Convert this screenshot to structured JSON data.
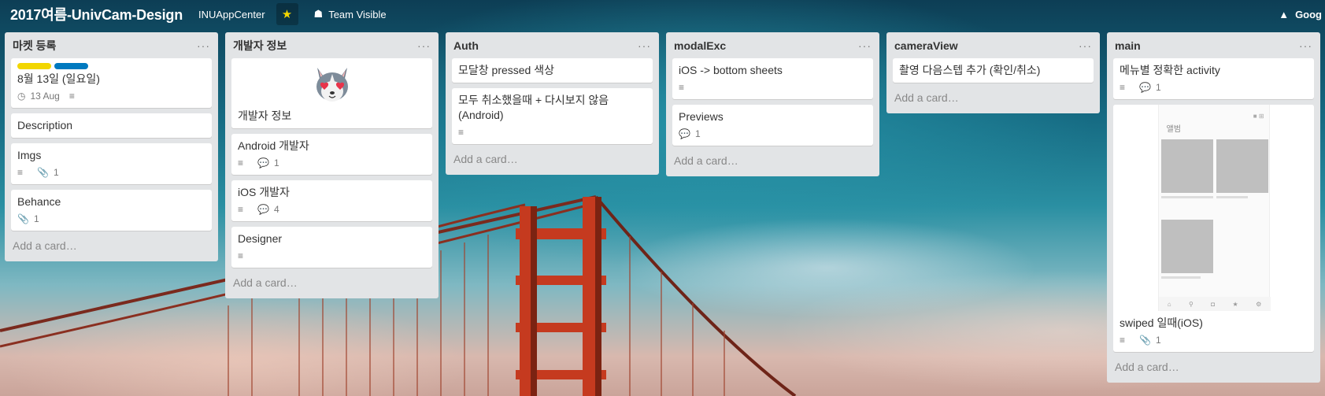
{
  "header": {
    "board_title": "2017여름-UnivCam-Design",
    "team_name": "INUAppCenter",
    "star_icon": "★",
    "visibility_label": "Team Visible",
    "visibility_icon": "☗",
    "right_label": "Goog",
    "right_icon": "▲"
  },
  "lists": [
    {
      "title": "마켓 등록",
      "menu": "···",
      "add_card": "Add a card…",
      "cards": [
        {
          "title": "8월 13일 (일요일)",
          "labels": [
            "#f2d600",
            "#0079bf"
          ],
          "due": "13 Aug"
        },
        {
          "title": "Description"
        },
        {
          "title": "Imgs",
          "attachments": "1"
        },
        {
          "title": "Behance",
          "attachments": "1"
        }
      ]
    },
    {
      "title": "개발자 정보",
      "menu": "···",
      "add_card": "Add a card…",
      "cards": [
        {
          "title": "개발자 정보"
        },
        {
          "title": "Android 개발자",
          "comments": "1"
        },
        {
          "title": "iOS 개발자",
          "comments": "4"
        },
        {
          "title": "Designer"
        }
      ]
    },
    {
      "title": "Auth",
      "menu": "···",
      "add_card": "Add a card…",
      "cards": [
        {
          "title": "모달창 pressed 색상"
        },
        {
          "title": "모두 취소했을때 + 다시보지 않음 (Android)"
        }
      ]
    },
    {
      "title": "modalExc",
      "menu": "···",
      "add_card": "Add a card…",
      "cards": [
        {
          "title": "iOS -> bottom sheets"
        },
        {
          "title": "Previews",
          "comments": "1"
        }
      ]
    },
    {
      "title": "cameraView",
      "menu": "···",
      "add_card": "Add a card…",
      "cards": [
        {
          "title": "촬영 다음스텝 추가 (확인/취소)"
        }
      ]
    },
    {
      "title": "main",
      "menu": "···",
      "add_card": "Add a card…",
      "cards": [
        {
          "title": "메뉴별 정확한 activity",
          "comments": "1"
        },
        {
          "title": "swiped 일때(iOS)",
          "attachments": "1",
          "cover_title": "앨범"
        }
      ]
    }
  ],
  "icons": {
    "description": "≡",
    "comment": "💬",
    "attachment": "📎",
    "clock": "◷"
  },
  "colors": {
    "list_bg": "#e2e4e6",
    "label_yellow": "#f2d600",
    "label_blue": "#0079bf"
  }
}
